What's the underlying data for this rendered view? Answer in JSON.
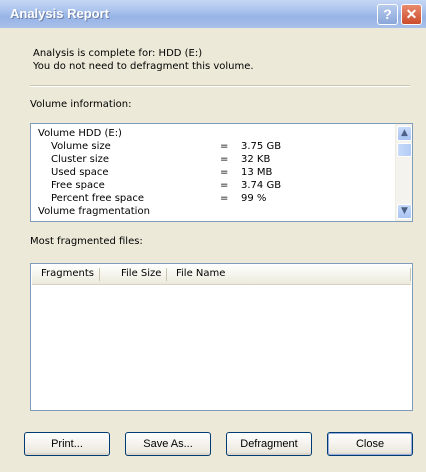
{
  "window": {
    "title": "Analysis Report",
    "help_glyph": "?",
    "close_glyph": "✕"
  },
  "message": {
    "line1": "Analysis is complete for: HDD (E:)",
    "line2": "You do not need to defragment this volume."
  },
  "volume_info": {
    "label": "Volume information:",
    "rows": [
      {
        "text": "Volume  HDD (E:)"
      },
      {
        "name": "Volume size",
        "eq": "=",
        "value": "3.75 GB"
      },
      {
        "name": "Cluster size",
        "eq": "=",
        "value": "32 KB"
      },
      {
        "name": "Used space",
        "eq": "=",
        "value": "13 MB"
      },
      {
        "name": "Free space",
        "eq": "=",
        "value": "3.74 GB"
      },
      {
        "name": "Percent free space",
        "eq": "=",
        "value": "99 %"
      },
      {
        "text": "Volume fragmentation"
      }
    ],
    "scroll_up_glyph": "▲",
    "scroll_down_glyph": "▼"
  },
  "fragmented": {
    "label": "Most fragmented files:",
    "columns": [
      "Fragments",
      "File Size",
      "File Name"
    ]
  },
  "buttons": {
    "print": "Print...",
    "save_as": "Save As...",
    "defragment": "Defragment",
    "close": "Close"
  }
}
